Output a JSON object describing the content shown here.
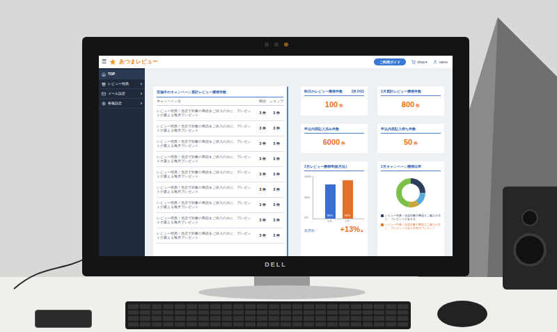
{
  "monitor": {
    "brand": "DELL"
  },
  "app": {
    "header": {
      "menu_glyph": "☰",
      "logo": "あつまレビュー",
      "guide_button": "ご利用ガイド",
      "shop_menu": "shop ▾",
      "user": "name"
    },
    "sidebar": {
      "items": [
        {
          "label": "TOP",
          "arrow": "",
          "selected": true
        },
        {
          "label": "レビュー特典",
          "arrow": "›",
          "selected": false
        },
        {
          "label": "メール設定",
          "arrow": "›",
          "selected": false
        },
        {
          "label": "各種設定",
          "arrow": "›",
          "selected": false
        }
      ]
    },
    "campaign_table": {
      "title": "実施中のキャンペーン累計レビュー獲得件数",
      "columns": [
        "キャンペーン名",
        "商品",
        "ショップ"
      ],
      "rows": [
        {
          "name": "レビュー特典！当店で対象の商品をご購入の方に、プレゼントが貰える毎月プレゼント",
          "product": "3 件",
          "shop": "3 件"
        },
        {
          "name": "レビュー特典！当店で対象の商品をご購入の方に、プレゼントが貰える毎月プレゼント",
          "product": "3 件",
          "shop": "3 件"
        },
        {
          "name": "レビュー特典！当店で対象の商品をご購入の方に、プレゼントが貰える毎月プレゼント",
          "product": "3 件",
          "shop": "3 件"
        },
        {
          "name": "レビュー特典！当店で対象の商品をご購入の方に、プレゼントが貰える毎月プレゼント",
          "product": "3 件",
          "shop": "3 件"
        },
        {
          "name": "レビュー特典！当店で対象の商品をご購入の方に、プレゼントが貰える毎月プレゼント",
          "product": "3 件",
          "shop": "3 件"
        },
        {
          "name": "レビュー特典！当店で対象の商品をご購入の方に、プレゼントが貰える毎月プレゼント",
          "product": "3 件",
          "shop": "3 件"
        },
        {
          "name": "レビュー特典！当店で対象の商品をご購入の方に、プレゼントが貰える毎月プレゼント",
          "product": "3 件",
          "shop": "3 件"
        },
        {
          "name": "レビュー特典！当店で対象の商品をご購入の方に、プレゼントが貰える毎月プレゼント",
          "product": "3 件",
          "shop": "3 件"
        },
        {
          "name": "レビュー特典！当店で対象の商品をご購入の方に、プレゼントが貰える毎月プレゼント",
          "product": "3 件",
          "shop": "3 件"
        }
      ]
    },
    "stats": [
      {
        "title": "昨日のレビュー獲得件数",
        "date": "2月24日",
        "value": "100",
        "unit": "件"
      },
      {
        "title": "2月累計レビュー獲得件数",
        "date": "",
        "value": "800",
        "unit": "件"
      },
      {
        "title": "申込内容記入済み件数",
        "date": "",
        "value": "6000",
        "unit": "件"
      },
      {
        "title": "申込内容記入待ち件数",
        "date": "",
        "value": "50",
        "unit": "件"
      }
    ],
    "rate_chart": {
      "title": "2月レビュー獲得率(前月比)",
      "ticks": [
        "100%",
        "50%",
        "0%"
      ],
      "bars": [
        {
          "label": "1月",
          "value": 80,
          "text": "80%",
          "color": "#3a6fd0"
        },
        {
          "label": "2月",
          "value": 90,
          "text": "90%",
          "color": "#e2702a"
        }
      ],
      "compare_label": "前月比",
      "compare_value": "+13%",
      "compare_arrow": "▲"
    },
    "ratio_chart": {
      "title": "2月キャンペーン獲得比率",
      "segments": [
        {
          "value": 25,
          "color": "#2c3e5c"
        },
        {
          "value": 15,
          "color": "#5aa9d6"
        },
        {
          "value": 12,
          "color": "#c9a73a"
        },
        {
          "value": 48,
          "color": "#7cc04a"
        }
      ],
      "legend": [
        {
          "text": "レビュー特典！当店対象の商品をご購入の方に、プレゼントが貰える",
          "color": "#2c3e5c"
        },
        {
          "text": "レビュー特典！当店対象の商品をご購入の方に、プレゼントが貰える毎月プレゼント",
          "color": "#e2702a"
        }
      ]
    }
  }
}
